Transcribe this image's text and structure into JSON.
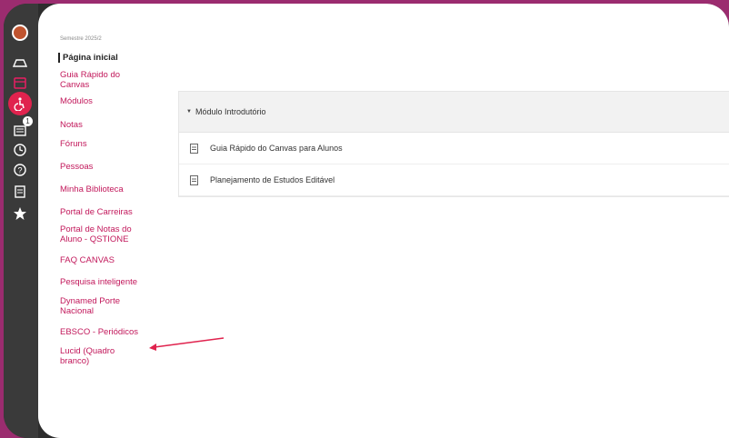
{
  "term": "Semestre 2025/2",
  "nav": {
    "items": [
      "Página inicial",
      "Guia Rápido do Canvas",
      "Módulos",
      "Notas",
      "Fóruns",
      "Pessoas",
      "Minha Biblioteca",
      "Portal de Carreiras",
      "Portal de Notas do Aluno - QSTIONE",
      "FAQ CANVAS",
      "Pesquisa inteligente",
      "Dynamed Porte Nacional",
      "EBSCO - Periódicos",
      "Lucid (Quadro branco)"
    ]
  },
  "module": {
    "title": "Módulo Introdutório",
    "items": [
      "Guia Rápido do Canvas para Alunos",
      "Planejamento de Estudos Editável"
    ]
  },
  "rail": {
    "badge": "1"
  },
  "colors": {
    "frame": "#9b2c6f",
    "link": "#c2185b",
    "accent": "#e0234e"
  },
  "icons": [
    "avatar-icon",
    "courses-icon",
    "calendar-icon",
    "accessibility-icon",
    "inbox-icon",
    "history-icon",
    "help-icon",
    "document-icon",
    "star-icon"
  ]
}
